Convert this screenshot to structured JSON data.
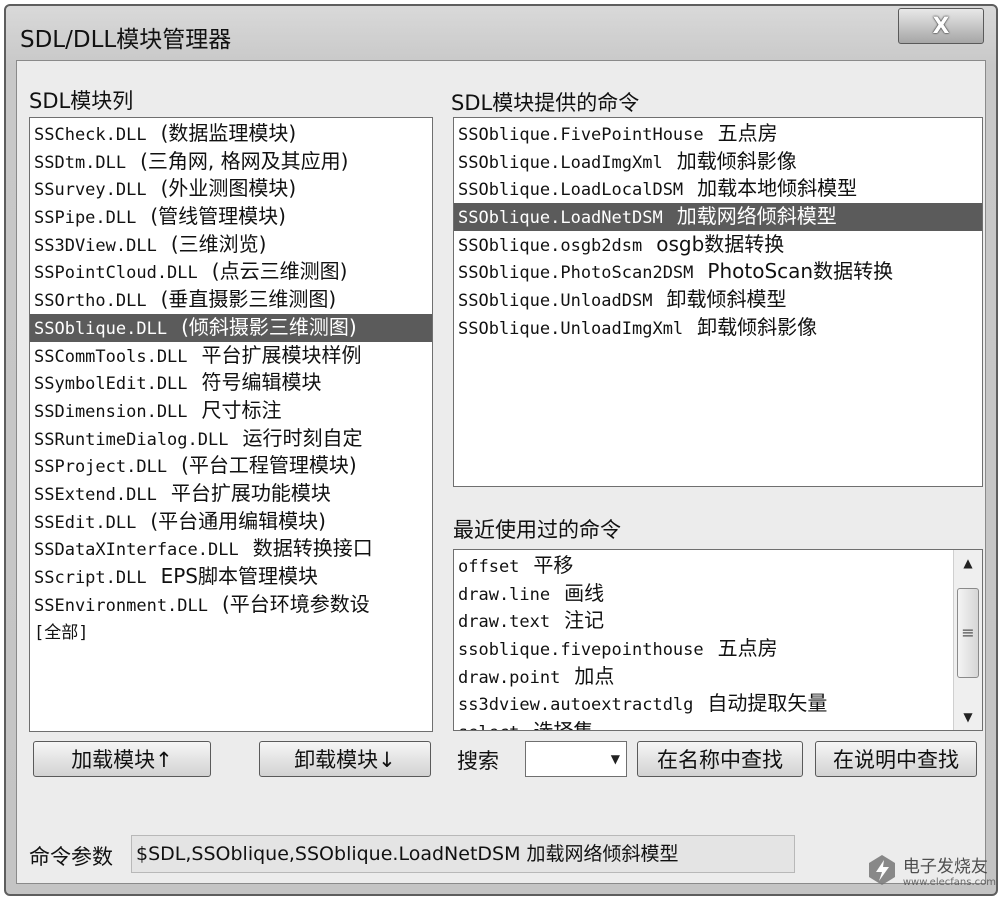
{
  "window": {
    "title": "SDL/DLL模块管理器",
    "close_label": "X"
  },
  "modules": {
    "label": "SDL模块列",
    "items": [
      {
        "name": "SSCheck.DLL",
        "desc": "(数据监理模块)"
      },
      {
        "name": "SSDtm.DLL",
        "desc": "(三角网, 格网及其应用)"
      },
      {
        "name": "SSurvey.DLL",
        "desc": "(外业测图模块)"
      },
      {
        "name": "SSPipe.DLL",
        "desc": "(管线管理模块)"
      },
      {
        "name": "SS3DView.DLL",
        "desc": "(三维浏览)"
      },
      {
        "name": "SSPointCloud.DLL",
        "desc": "(点云三维测图)"
      },
      {
        "name": "SSOrtho.DLL",
        "desc": "(垂直摄影三维测图)"
      },
      {
        "name": "SSOblique.DLL",
        "desc": "(倾斜摄影三维测图)",
        "selected": true
      },
      {
        "name": "SSCommTools.DLL",
        "desc": "平台扩展模块样例"
      },
      {
        "name": "SSymbolEdit.DLL",
        "desc": "符号编辑模块"
      },
      {
        "name": "SSDimension.DLL",
        "desc": "尺寸标注"
      },
      {
        "name": "SSRuntimeDialog.DLL",
        "desc": "运行时刻自定"
      },
      {
        "name": "SSProject.DLL",
        "desc": "(平台工程管理模块)"
      },
      {
        "name": "SSExtend.DLL",
        "desc": "平台扩展功能模块"
      },
      {
        "name": "SSEdit.DLL",
        "desc": "(平台通用编辑模块)"
      },
      {
        "name": "SSDataXInterface.DLL",
        "desc": "数据转换接口"
      },
      {
        "name": "SScript.DLL",
        "desc": "EPS脚本管理模块"
      },
      {
        "name": "SSEnvironment.DLL",
        "desc": "(平台环境参数设"
      },
      {
        "name": "[全部]",
        "desc": ""
      }
    ]
  },
  "commands": {
    "label": "SDL模块提供的命令",
    "items": [
      {
        "name": "SSOblique.FivePointHouse",
        "desc": "五点房"
      },
      {
        "name": "SSOblique.LoadImgXml",
        "desc": "加载倾斜影像"
      },
      {
        "name": "SSOblique.LoadLocalDSM",
        "desc": "加载本地倾斜模型"
      },
      {
        "name": "SSOblique.LoadNetDSM",
        "desc": "加载网络倾斜模型",
        "selected": true
      },
      {
        "name": "SSOblique.osgb2dsm",
        "desc": "osgb数据转换"
      },
      {
        "name": "SSOblique.PhotoScan2DSM",
        "desc": "PhotoScan数据转换"
      },
      {
        "name": "SSOblique.UnloadDSM",
        "desc": "卸载倾斜模型"
      },
      {
        "name": "SSOblique.UnloadImgXml",
        "desc": "卸载倾斜影像"
      }
    ]
  },
  "recent": {
    "label": "最近使用过的命令",
    "items": [
      {
        "name": "offset",
        "desc": "平移"
      },
      {
        "name": "draw.line",
        "desc": "画线"
      },
      {
        "name": "draw.text",
        "desc": "注记"
      },
      {
        "name": "ssoblique.fivepointhouse",
        "desc": "五点房"
      },
      {
        "name": "draw.point",
        "desc": "加点"
      },
      {
        "name": "ss3dview.autoextractdlg",
        "desc": "自动提取矢量"
      },
      {
        "name": "select",
        "desc": "选择集"
      }
    ]
  },
  "buttons": {
    "load": "加载模块↑",
    "unload": "卸载模块↓"
  },
  "search": {
    "label": "搜索",
    "value": "",
    "find_name": "在名称中查找",
    "find_desc": "在说明中查找"
  },
  "params": {
    "label": "命令参数",
    "value": "$SDL,SSOblique,SSOblique.LoadNetDSM 加载网络倾斜模型"
  },
  "watermark": {
    "text": "电子发烧友",
    "sub": "www.elecfans.com"
  }
}
